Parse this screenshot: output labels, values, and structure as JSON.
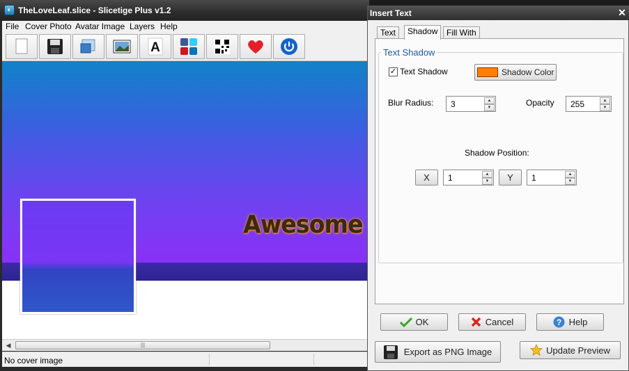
{
  "main_window": {
    "title": "TheLoveLeaf.slice - Slicetige Plus v1.2",
    "menu": [
      "File",
      "Cover Photo",
      "Avatar Image",
      "Layers",
      "Help"
    ],
    "toolbar_icons": [
      "new-file-icon",
      "save-icon",
      "cover-photo-icon",
      "image-icon",
      "text-icon",
      "social-icon",
      "qr-code-icon",
      "heart-icon",
      "power-icon"
    ],
    "canvas_text": "Awesome",
    "status_text": "No cover image"
  },
  "dialog": {
    "title": "Insert Text",
    "tabs": [
      {
        "label": "Text",
        "active": false
      },
      {
        "label": "Shadow",
        "active": true
      },
      {
        "label": "Fill With",
        "active": false
      }
    ],
    "group_title": "Text Shadow",
    "text_shadow_checkbox": {
      "label": "Text Shadow",
      "checked": true
    },
    "shadow_color_button": {
      "label": "Shadow Color",
      "color": "#ff8000"
    },
    "blur_radius": {
      "label": "Blur Radius:",
      "value": "3"
    },
    "opacity": {
      "label": "Opacity",
      "value": "255"
    },
    "shadow_position": {
      "label": "Shadow Position:",
      "x_label": "X",
      "x_value": "1",
      "y_label": "Y",
      "y_value": "1"
    },
    "buttons": {
      "ok": "OK",
      "cancel": "Cancel",
      "help": "Help",
      "export": "Export as PNG Image",
      "update_preview": "Update Preview"
    }
  },
  "colors": {
    "shadow_color": "#ff8000",
    "accent_text": "#1c5ca8"
  }
}
